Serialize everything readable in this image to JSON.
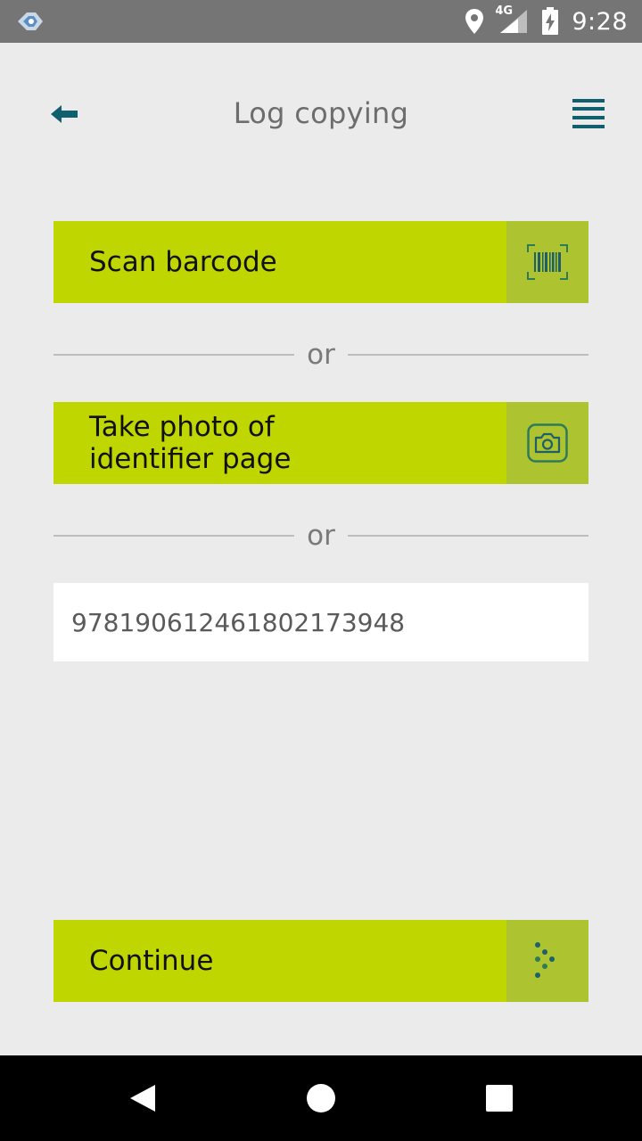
{
  "status_bar": {
    "time": "9:28",
    "network": "4G",
    "icons": [
      "app-notification-icon",
      "location-icon",
      "cellular-signal-icon",
      "battery-charging-icon"
    ]
  },
  "header": {
    "title": "Log copying",
    "back_icon": "arrow-left-icon",
    "menu_icon": "hamburger-menu-icon"
  },
  "actions": {
    "scan_label": "Scan barcode",
    "scan_icon": "barcode-scan-icon",
    "photo_label_line1": "Take photo of",
    "photo_label_line2": "identifier page",
    "photo_icon": "camera-icon",
    "divider_text": "or",
    "continue_label": "Continue",
    "continue_icon": "dotted-arrow-icon"
  },
  "identifier_input": {
    "value": "97819061246180​2173948"
  },
  "navigation": {
    "icons": [
      "nav-back-icon",
      "nav-home-icon",
      "nav-recent-icon"
    ]
  },
  "colors": {
    "accent_green": "#bfd600",
    "accent_green_dark": "#adc32f",
    "teal": "#0f5f6e",
    "background": "#ebebeb"
  }
}
